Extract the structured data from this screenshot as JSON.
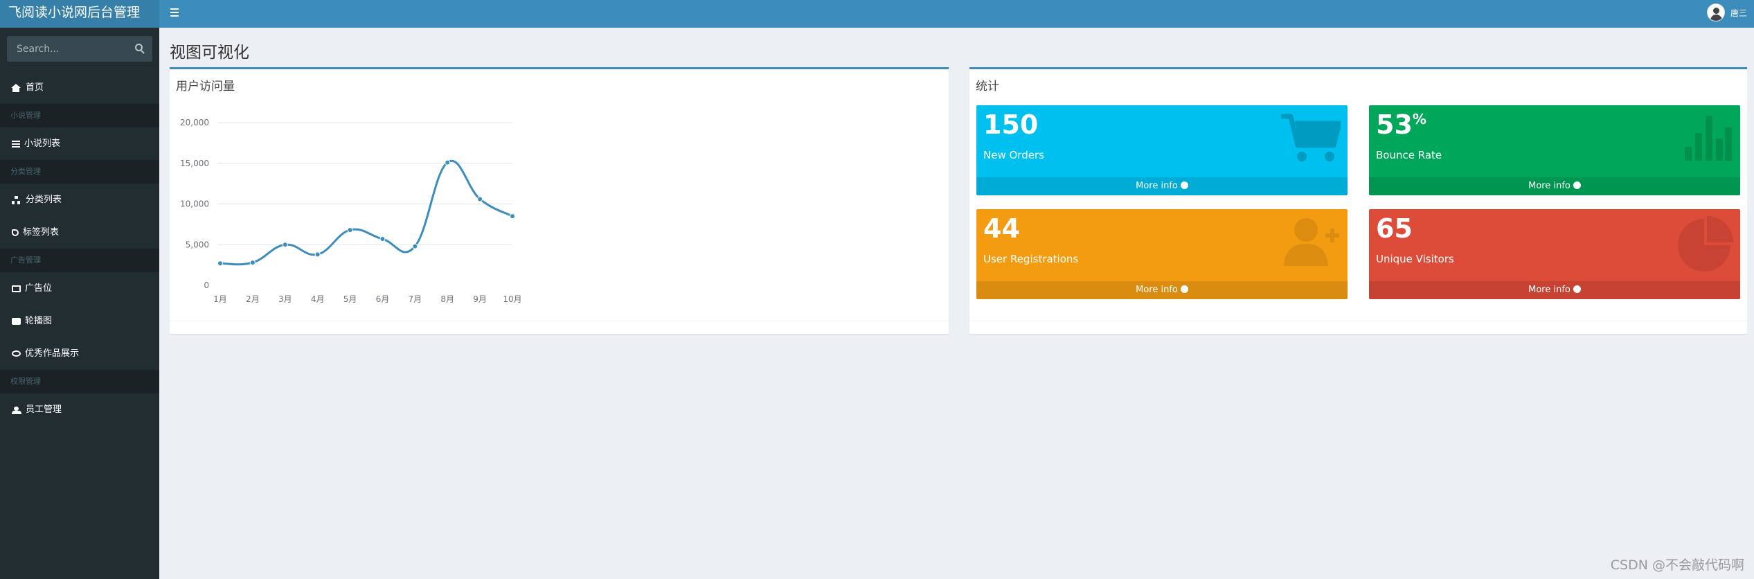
{
  "header": {
    "logo": "飞阅读小说网后台管理",
    "user_name": "唐三"
  },
  "sidebar": {
    "search_placeholder": "Search...",
    "items": [
      {
        "type": "item",
        "label": "首页",
        "icon": "home-icon"
      },
      {
        "type": "header",
        "label": "小说管理"
      },
      {
        "type": "item",
        "label": "小说列表",
        "icon": "list-icon"
      },
      {
        "type": "header",
        "label": "分类管理"
      },
      {
        "type": "item",
        "label": "分类列表",
        "icon": "sitemap-icon"
      },
      {
        "type": "item",
        "label": "标签列表",
        "icon": "tag-icon"
      },
      {
        "type": "header",
        "label": "广告管理"
      },
      {
        "type": "item",
        "label": "广告位",
        "icon": "monitor-icon"
      },
      {
        "type": "item",
        "label": "轮播图",
        "icon": "images-icon"
      },
      {
        "type": "item",
        "label": "优秀作品展示",
        "icon": "eye-icon"
      },
      {
        "type": "header",
        "label": "权限管理"
      },
      {
        "type": "item",
        "label": "员工管理",
        "icon": "users-icon"
      }
    ]
  },
  "main": {
    "page_title": "视图可视化",
    "chart_box_title": "用户访问量",
    "stats_box_title": "统计",
    "stats": [
      {
        "value": "150",
        "suffix": "",
        "label": "New Orders",
        "link": "More info",
        "color": "#00c0ef",
        "icon": "shopping-cart-icon"
      },
      {
        "value": "53",
        "suffix": "%",
        "label": "Bounce Rate",
        "link": "More info",
        "color": "#00a65a",
        "icon": "bar-chart-icon"
      },
      {
        "value": "44",
        "suffix": "",
        "label": "User Registrations",
        "link": "More info",
        "color": "#f39c12",
        "icon": "user-plus-icon"
      },
      {
        "value": "65",
        "suffix": "",
        "label": "Unique Visitors",
        "link": "More info",
        "color": "#dd4b39",
        "icon": "pie-chart-icon"
      }
    ]
  },
  "chart_data": {
    "type": "line",
    "smooth": true,
    "categories": [
      "1月",
      "2月",
      "3月",
      "4月",
      "5月",
      "6月",
      "7月",
      "8月",
      "9月",
      "10月"
    ],
    "values": [
      2700,
      2800,
      5000,
      3800,
      6800,
      5700,
      4800,
      15100,
      10600,
      8500
    ],
    "ylim": [
      0,
      20000
    ],
    "yticks": [
      "0",
      "5,000",
      "10,000",
      "15,000",
      "20,000"
    ],
    "grid": true,
    "color": "#3c8dbc"
  },
  "watermark": "CSDN @不会敲代码啊"
}
